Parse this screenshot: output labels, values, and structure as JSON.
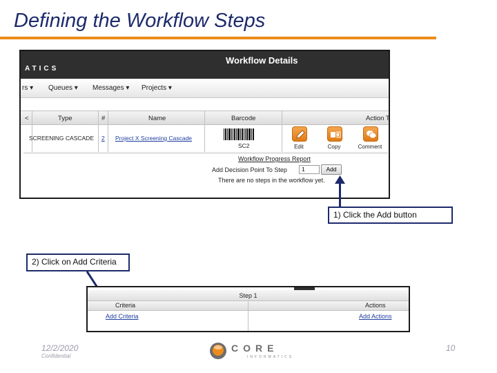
{
  "slide": {
    "title": "Defining the Workflow Steps",
    "date": "12/2/2020",
    "confidential": "Confidential",
    "page_number": "10"
  },
  "screenshot1": {
    "brand_partial": "ATICS",
    "heading": "Workflow Details",
    "nav": [
      "rs ▾",
      "Queues ▾",
      "Messages ▾",
      "Projects ▾"
    ],
    "columns": {
      "left": "<",
      "type": "Type",
      "num": "#",
      "name": "Name",
      "barcode": "Barcode",
      "action": "Action T"
    },
    "row": {
      "type": "SCREENING CASCADE",
      "num": "2",
      "name": "Project X Screening Cascade",
      "barcode_text": "SC2"
    },
    "actions": [
      {
        "label": "Edit",
        "icon": "pencil-icon"
      },
      {
        "label": "Copy",
        "icon": "copy-icon"
      },
      {
        "label": "Comment",
        "icon": "comment-icon"
      }
    ],
    "report_link": "Workflow Progress Report",
    "add_decision_label": "Add Decision Point To Step",
    "step_value": "1",
    "add_button": "Add",
    "no_steps_text": "There are no steps in the workflow yet."
  },
  "callouts": {
    "click_add": "1) Click the Add button",
    "click_criteria": "2) Click on Add Criteria"
  },
  "screenshot2": {
    "step_header": "Step 1",
    "criteria_header": "Criteria",
    "actions_header": "Actions",
    "add_criteria": "Add Criteria",
    "add_actions": "Add Actions"
  },
  "logo": {
    "word": "CORE",
    "sub": "INFORMATICS"
  },
  "colors": {
    "title": "#1c2a6b",
    "rule": "#ec8c1c",
    "header": "#2f2f2f",
    "action_icon": "#e88a24",
    "link": "#1f3ea0"
  }
}
